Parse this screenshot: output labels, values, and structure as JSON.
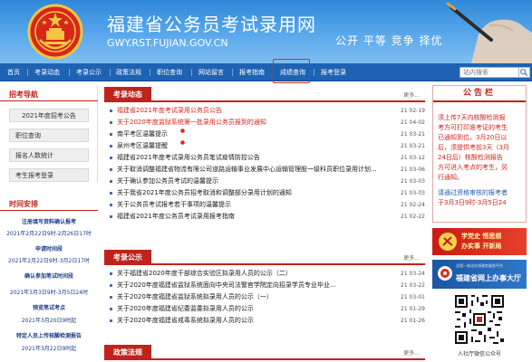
{
  "header": {
    "title": "福建省公务员考试录用网",
    "domain": "GWY.RST.FUJIAN.GOV.CN",
    "slogan": "公开 平等 竞争 择优"
  },
  "nav": {
    "items": [
      "首页",
      "考录动态",
      "考录公示",
      "政策法规",
      "职位查询",
      "网站留言",
      "报考指南",
      "成绩查询",
      "报考登录"
    ],
    "highlighted": "成绩查询",
    "search_placeholder": "站内搜索"
  },
  "left": {
    "guide_title": "招考导航",
    "guide_items": [
      "2021年度招考公告",
      "职位查询",
      "报名人数统计",
      "考生报考登录"
    ],
    "schedule_title": "时间安排",
    "schedule": [
      {
        "title": "注册填写资料确认报考",
        "date": "2021年2月22日9时-2月26日17时"
      },
      {
        "title": "申请时间段",
        "date": "2021年2月22日9时-3月2日17时"
      },
      {
        "title": "确认参加笔试时间段",
        "date": "2021年3月3日9时-3月5日24时"
      },
      {
        "title": "预览笔试考点",
        "date": "2021年3月20日9时起"
      },
      {
        "title": "特定人员上传核酸检测报告",
        "date": "2021年3月22日9时起"
      }
    ]
  },
  "center": {
    "more_label": "更多...",
    "news_title": "考录动态",
    "news": [
      {
        "title": "福建省2021年度考试录用公务员公告",
        "date": "21 02-19",
        "red": true,
        "new": false
      },
      {
        "title": "关于2020年度监狱系统第一批录用公务员报到的通知",
        "date": "21 04-02",
        "red": true,
        "new": false
      },
      {
        "title": "南平考区温馨提示",
        "date": "21 03-21",
        "red": false,
        "new": true
      },
      {
        "title": "泉州考区温馨提醒",
        "date": "21 03-21",
        "red": false,
        "new": true
      },
      {
        "title": "福建省2021年度考试录用公务员笔试疫情防控公告",
        "date": "21 03-12",
        "red": false,
        "new": false
      },
      {
        "title": "关于取消调整福建省物流有限公司道路运输事业发展中心运输管理股一级科员职位录用计划...",
        "date": "21 03-06",
        "red": false,
        "new": false
      },
      {
        "title": "关于确认参加公务员考试的温馨提示",
        "date": "21 03-03",
        "red": false,
        "new": false
      },
      {
        "title": "关于我省2021年度公务员招考取消和调整部分录用计划的通知",
        "date": "21 03-03",
        "red": false,
        "new": false
      },
      {
        "title": "关于公务员考试报考若干事项的温馨提示",
        "date": "21 02-24",
        "red": false,
        "new": false
      },
      {
        "title": "福建省2021年度公务员考试录用报考指南",
        "date": "21 02-22",
        "red": false,
        "new": false
      }
    ],
    "notices_title": "考录公示",
    "notices": [
      {
        "title": "关于福建省2020年度干部综合实验区拟录用人员的公示（二）",
        "date": "21 03-24"
      },
      {
        "title": "关于2020年度福建省监狱系统面向中央司法警官学院定向招录学员专业毕业...",
        "date": "21 03-22"
      },
      {
        "title": "关于2020年度福建省监狱系统拟录用人员的公示（一）",
        "date": "21 03-01"
      },
      {
        "title": "关于2020年度福建省纪委监委拟录用人员的公示",
        "date": "21 01-29"
      },
      {
        "title": "关于2020年度福建省戒毒系统拟录用人员的公示",
        "date": "21 01-26"
      }
    ],
    "policy_title": "政策法规"
  },
  "right": {
    "notice_title": "公告栏",
    "notice_lines": [
      {
        "text": "须上传7天内核酸检测报",
        "color": "red"
      },
      {
        "text": "考方可打印准考证的考生",
        "color": "red"
      },
      {
        "text": "已通知到位。3月20日以",
        "color": "red"
      },
      {
        "text": "后，须提供考前3天（3月",
        "color": "red"
      },
      {
        "text": "24日后）核酸检测报告",
        "color": "red"
      },
      {
        "text": "方可进入考点的考生，另",
        "color": "red"
      },
      {
        "text": "行通知。",
        "color": "red"
      },
      {
        "text": "请通过资格审核的报考者",
        "color": "blue"
      },
      {
        "text": "于3月3日9时-3月5日24",
        "color": "red"
      }
    ],
    "banner1_lines": [
      "学党史 悟思想",
      "办实事 开新局"
    ],
    "banner2_small": "全国一体化在线政务服务平台",
    "banner2_text": "福建省网上办事大厅",
    "qr_caption": "人社厅微信公众号"
  },
  "colors": {
    "brand_red": "#c0231b",
    "nav_blue": "#1e63b3",
    "header_blue": "#2f88d8"
  }
}
